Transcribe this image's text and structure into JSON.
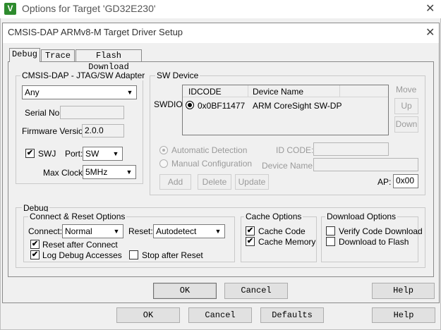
{
  "outer": {
    "title": "Options for Target 'GD32E230'",
    "icon": "V",
    "close": "✕",
    "buttons": {
      "ok": "OK",
      "cancel": "Cancel",
      "defaults": "Defaults",
      "help": "Help"
    }
  },
  "dialog": {
    "title": "CMSIS-DAP ARMv8-M Target Driver Setup",
    "close": "✕",
    "tabs": [
      "Debug",
      "Trace",
      "Flash Download"
    ],
    "active_tab": "Debug",
    "adapter": {
      "legend": "CMSIS-DAP - JTAG/SW Adapter",
      "selected": "Any",
      "serial_label": "Serial No:",
      "serial_value": "",
      "firmware_label": "Firmware Version:",
      "firmware_value": "2.0.0",
      "swj_label": "SWJ",
      "swj_checked": true,
      "port_label": "Port:",
      "port_value": "SW",
      "maxclock_label": "Max Clock:",
      "maxclock_value": "5MHz"
    },
    "swdevice": {
      "legend": "SW Device",
      "row_label": "SWDIO",
      "columns": [
        "IDCODE",
        "Device Name"
      ],
      "rows": [
        {
          "idcode": "0x0BF11477",
          "name": "ARM CoreSight SW-DP"
        }
      ],
      "move_label": "Move",
      "up": "Up",
      "down": "Down",
      "auto_detect": "Automatic Detection",
      "manual_config": "Manual Configuration",
      "id_code_label": "ID CODE:",
      "device_name_label": "Device Name:",
      "add": "Add",
      "delete": "Delete",
      "update": "Update",
      "ap_label": "AP:",
      "ap_value": "0x00"
    },
    "debug": {
      "legend": "Debug",
      "connect_reset": {
        "legend": "Connect & Reset Options",
        "connect_label": "Connect:",
        "connect_value": "Normal",
        "reset_label": "Reset:",
        "reset_value": "Autodetect",
        "reset_after_connect": "Reset after Connect",
        "log_debug": "Log Debug Accesses",
        "stop_after_reset": "Stop after Reset"
      },
      "cache": {
        "legend": "Cache Options",
        "cache_code": "Cache Code",
        "cache_memory": "Cache Memory"
      },
      "download": {
        "legend": "Download Options",
        "verify": "Verify Code Download",
        "download_flash": "Download to Flash"
      }
    },
    "buttons": {
      "ok": "OK",
      "cancel": "Cancel",
      "help": "Help"
    }
  },
  "checks": {
    "on": "✔",
    "off": ""
  },
  "colors": {
    "outer_icon": "#2e8b2e",
    "dialog_bg": "#f0f0f0"
  }
}
